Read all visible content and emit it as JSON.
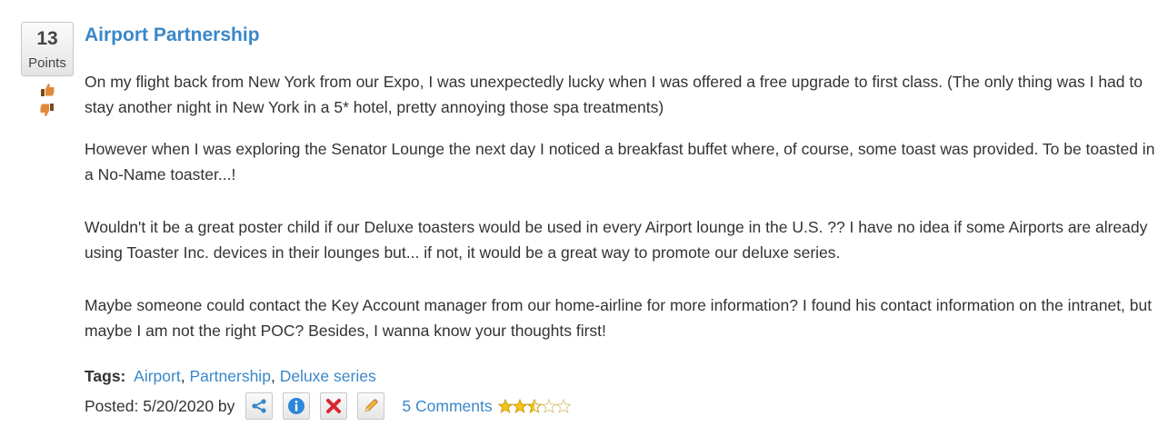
{
  "post": {
    "points": "13",
    "points_label": "Points",
    "title": "Airport Partnership",
    "paragraphs": [
      "On my flight back from New York from our Expo, I was unexpectedly lucky when I was offered a free upgrade to first class. (The only thing was I had to stay another night in New York in a 5* hotel, pretty annoying those spa treatments)",
      "However when I was exploring the Senator Lounge the next day I noticed a breakfast buffet where, of course, some toast was provided. To be toasted in a No-Name toaster...!",
      "Wouldn't it be a great poster child if our Deluxe toasters would be used in every Airport lounge in the U.S. ?? I have no idea if some Airports are already using Toaster Inc. devices in their lounges but... if not, it would be a great way to promote our deluxe series.",
      "Maybe someone could contact the Key Account manager from our home-airline for more information? I found his contact information on the intranet, but maybe I am not the right POC? Besides, I wanna know your thoughts first!"
    ],
    "tags_label": "Tags:",
    "tags": [
      "Airport",
      "Partnership",
      "Deluxe series"
    ],
    "tag_separator": ",",
    "posted_text": "Posted: 5/20/2020 by",
    "comments_label": "5 Comments",
    "rating": 2.5,
    "rating_max": 5,
    "icons": {
      "upvote": "thumbs-up-icon",
      "downvote": "thumbs-down-icon",
      "share": "share-icon",
      "info": "info-icon",
      "delete": "delete-icon",
      "edit": "pencil-icon",
      "rating": "star-icon"
    },
    "colors": {
      "link": "#3a87c8",
      "text": "#333333",
      "star": "#f5c518",
      "delete": "#d9272e",
      "info": "#2d87d8",
      "thumb": "#e08a3c"
    }
  }
}
